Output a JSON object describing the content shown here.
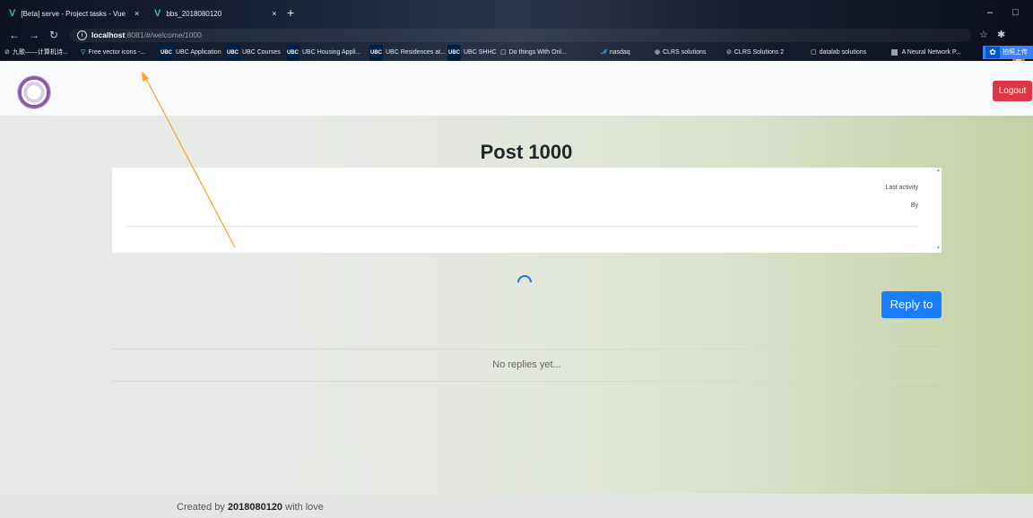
{
  "browser": {
    "tabs": [
      {
        "label": "[Beta] serve - Project tasks - Vue",
        "close": "×"
      },
      {
        "label": "bbs_2018080120",
        "close": "×"
      }
    ],
    "new_tab": "+",
    "url": {
      "host": "localhost",
      "rest": ":8081/#/welcome/1000"
    },
    "bookmarks": [
      {
        "icon": "globe",
        "label": "九歌——计算机诗..."
      },
      {
        "icon": "v",
        "label": "Free vector icons -..."
      },
      {
        "icon": "ubc",
        "label": "UBC Application"
      },
      {
        "icon": "ubc",
        "label": "UBC Courses"
      },
      {
        "icon": "ubc",
        "label": "UBC Housing Appli..."
      },
      {
        "icon": "ubc",
        "label": "UBC Residences at..."
      },
      {
        "icon": "ubc",
        "label": "UBC SHHC"
      },
      {
        "icon": "box",
        "label": "Do things With Onl..."
      },
      {
        "icon": "nas",
        "label": "nasdaq"
      },
      {
        "icon": "rt",
        "label": "CLRS solutions"
      },
      {
        "icon": "globe",
        "label": "CLRS Solutions 2"
      },
      {
        "icon": "box",
        "label": "datalab solutions"
      },
      {
        "icon": "sq",
        "label": "A Neural Network P..."
      }
    ],
    "upload_label": "拍照上传"
  },
  "app": {
    "logout_label": "Logout",
    "post_title": "Post 1000",
    "last_activity_label": "Last activity",
    "by_label": "By",
    "reply_label": "Reply to",
    "no_replies": "No replies yet...",
    "footer": {
      "prefix": "Created by",
      "author": "2018080120",
      "suffix": "with love"
    }
  },
  "colors": {
    "logout": "#dc3545",
    "reply": "#1a7cff",
    "spinner": "#1a73e8",
    "annotation": "#f5a623"
  }
}
